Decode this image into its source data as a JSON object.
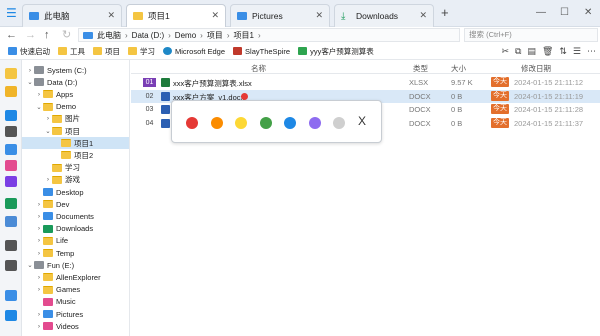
{
  "tabs": [
    {
      "label": "此电脑",
      "icon": "computer-icon"
    },
    {
      "label": "项目1",
      "icon": "folder-icon"
    },
    {
      "label": "Pictures",
      "icon": "pictures-icon"
    },
    {
      "label": "Downloads",
      "icon": "download-icon"
    }
  ],
  "address": {
    "crumbs": [
      "此电脑",
      "Data (D:)",
      "Demo",
      "项目",
      "项目1"
    ],
    "search_placeholder": "搜索 (Ctrl+F)"
  },
  "bookmarks": [
    {
      "label": "快速启动",
      "color": "#3a8ee6"
    },
    {
      "label": "工具",
      "color": "#f4c542"
    },
    {
      "label": "项目",
      "color": "#f4c542"
    },
    {
      "label": "学习",
      "color": "#f4c542"
    },
    {
      "label": "Microsoft Edge",
      "color": "#1e88c7"
    },
    {
      "label": "SlayTheSpire",
      "color": "#c0392b"
    },
    {
      "label": "yyy客户预算测算表",
      "color": "#2ea44f"
    }
  ],
  "tree": [
    {
      "label": "System (C:)",
      "icon": "drive",
      "level": 0,
      "chev": "›"
    },
    {
      "label": "Data (D:)",
      "icon": "drive",
      "level": 0,
      "chev": "⌄"
    },
    {
      "label": "Apps",
      "icon": "folder",
      "level": 1,
      "chev": "›"
    },
    {
      "label": "Demo",
      "icon": "folder",
      "level": 1,
      "chev": "⌄"
    },
    {
      "label": "图片",
      "icon": "folder",
      "level": 2,
      "chev": "›"
    },
    {
      "label": "项目",
      "icon": "folder",
      "level": 2,
      "chev": "⌄"
    },
    {
      "label": "项目1",
      "icon": "folder",
      "level": 3,
      "chev": "",
      "selected": true
    },
    {
      "label": "项目2",
      "icon": "folder",
      "level": 3,
      "chev": ""
    },
    {
      "label": "学习",
      "icon": "folder",
      "level": 2,
      "chev": ""
    },
    {
      "label": "游戏",
      "icon": "folder",
      "level": 2,
      "chev": "›"
    },
    {
      "label": "Desktop",
      "icon": "blue",
      "level": 1,
      "chev": ""
    },
    {
      "label": "Dev",
      "icon": "folder",
      "level": 1,
      "chev": "›"
    },
    {
      "label": "Documents",
      "icon": "blue",
      "level": 1,
      "chev": "›"
    },
    {
      "label": "Downloads",
      "icon": "dl",
      "level": 1,
      "chev": "›"
    },
    {
      "label": "Life",
      "icon": "folder",
      "level": 1,
      "chev": "›"
    },
    {
      "label": "Temp",
      "icon": "folder",
      "level": 1,
      "chev": "›"
    },
    {
      "label": "Fun (E:)",
      "icon": "drive",
      "level": 0,
      "chev": "⌄"
    },
    {
      "label": "AllenExplorer",
      "icon": "folder",
      "level": 1,
      "chev": "›"
    },
    {
      "label": "Games",
      "icon": "folder",
      "level": 1,
      "chev": "›"
    },
    {
      "label": "Music",
      "icon": "pink",
      "level": 1,
      "chev": ""
    },
    {
      "label": "Pictures",
      "icon": "blue",
      "level": 1,
      "chev": "›"
    },
    {
      "label": "Videos",
      "icon": "pink",
      "level": 1,
      "chev": "›"
    }
  ],
  "columns": {
    "name": "名称",
    "type": "类型",
    "size": "大小",
    "modified": "修改日期"
  },
  "files": [
    {
      "num": "01",
      "name": "xxx客户预算测算表.xlsx",
      "type": "XLSX",
      "size": "9.57 K",
      "badge": "今天",
      "date": "2024-01-15  21:11:12",
      "icon_color": "#1e7b3c",
      "num_color": "#7a3fb5"
    },
    {
      "num": "02",
      "name": "xxx客户方案_v1.docx",
      "type": "DOCX",
      "size": "0 B",
      "badge": "今天",
      "date": "2024-01-15  21:11:19",
      "icon_color": "#2b5fb3",
      "num_color": "",
      "tag_color": "#e53935",
      "selected": true
    },
    {
      "num": "03",
      "name": "",
      "type": "DOCX",
      "size": "0 B",
      "badge": "今天",
      "date": "2024-01-15  21:11:28",
      "icon_color": "#2b5fb3",
      "num_color": ""
    },
    {
      "num": "04",
      "name": "",
      "type": "DOCX",
      "size": "0 B",
      "badge": "今天",
      "date": "2024-01-15  21:11:37",
      "icon_color": "#2b5fb3",
      "num_color": ""
    }
  ],
  "color_popup": {
    "colors": [
      "#e53935",
      "#fb8c00",
      "#fdd835",
      "#43a047",
      "#1e88e5",
      "#8e6cf0",
      "#cfcfcf"
    ],
    "close_label": "X"
  }
}
